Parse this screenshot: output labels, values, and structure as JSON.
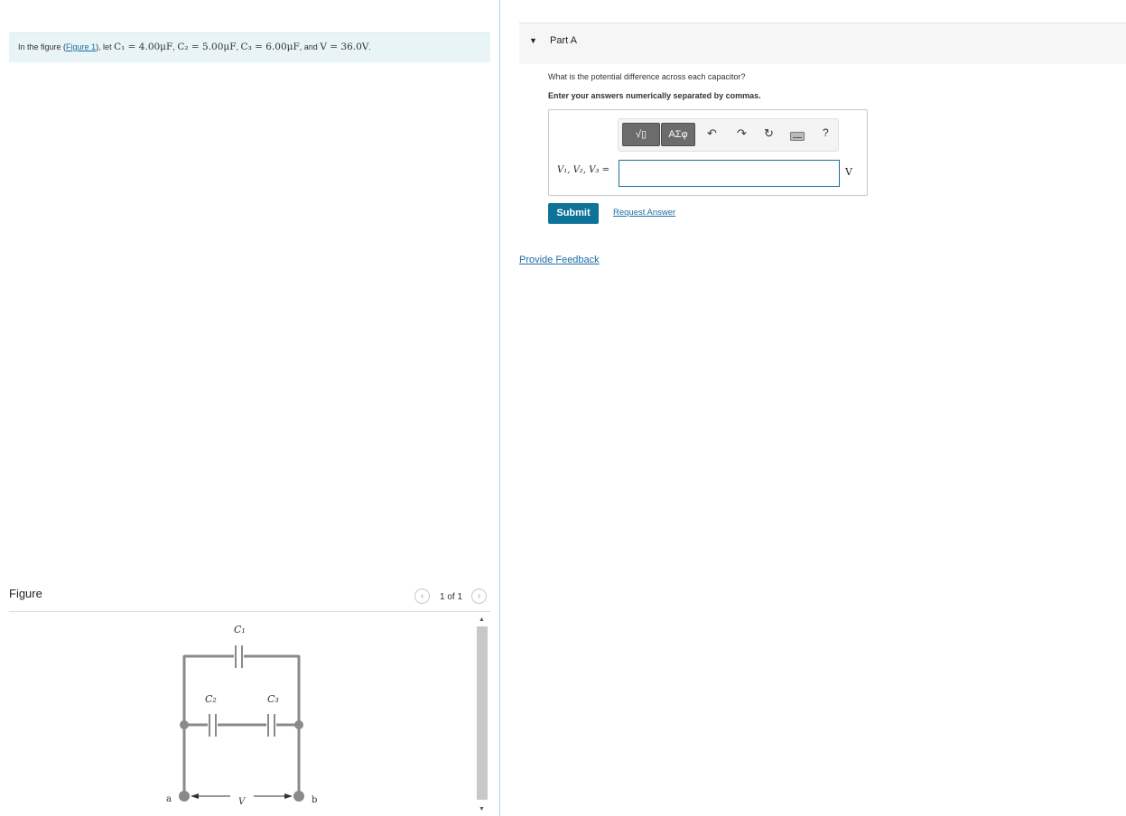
{
  "problem": {
    "prefix": "In the figure (",
    "figure_link": "Figure 1",
    "after_link": "), let ",
    "c1": "C₁ = 4.00μF",
    "c2": "C₂ = 5.00μF",
    "c3": "C₃ = 6.00μF",
    "and_text": "and",
    "voltage": "V = 36.0V",
    "sep": ", ",
    "end": "."
  },
  "figure": {
    "title": "Figure",
    "pager_text": "1 of 1",
    "prev_icon": "chevron-left-icon",
    "next_icon": "chevron-right-icon",
    "labels": {
      "c1": "C₁",
      "c2": "C₂",
      "c3": "C₃",
      "node_a": "a",
      "node_b": "b",
      "voltage": "V"
    }
  },
  "part": {
    "label": "Part A",
    "question": "What is the potential difference across each capacitor?",
    "instruction": "Enter your answers numerically separated by commas.",
    "toolbar": {
      "templates_icon": "templates-sqrt-icon",
      "templates_text": "√▯",
      "symbols_label": "ΑΣφ",
      "undo_icon": "undo-icon",
      "redo_icon": "redo-icon",
      "reset_icon": "reset-icon",
      "keyboard_icon": "keyboard-icon",
      "help_label": "?"
    },
    "answer_label": "V₁, V₂, V₃ =",
    "answer_value": "",
    "unit": "V",
    "submit_label": "Submit",
    "request_label": "Request Answer"
  },
  "feedback_label": "Provide Feedback",
  "colors": {
    "accent": "#0d7398",
    "link": "#1c6ea4",
    "problem_bg": "#e8f4f6",
    "circuit_wire": "#8a8a8a"
  }
}
